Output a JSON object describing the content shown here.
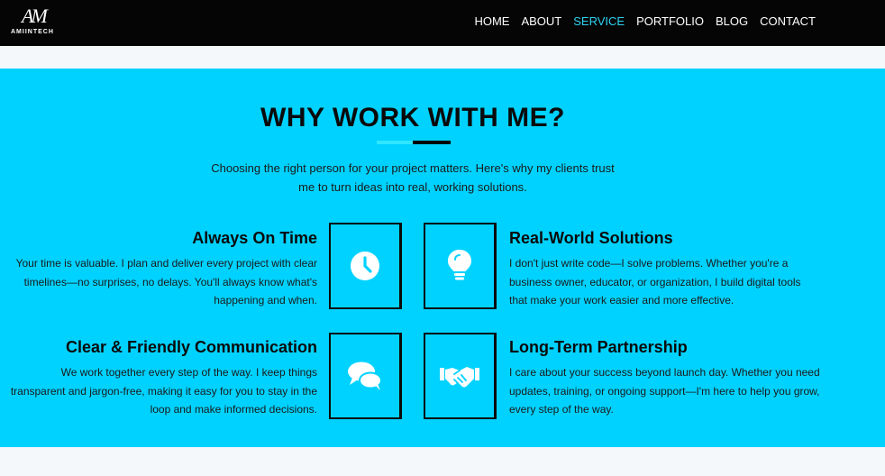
{
  "brand": {
    "logo_mark": "AM",
    "logo_text": "AMIINTECH"
  },
  "nav": [
    {
      "label": "HOME",
      "active": false
    },
    {
      "label": "ABOUT",
      "active": false
    },
    {
      "label": "SERVICE",
      "active": true
    },
    {
      "label": "PORTFOLIO",
      "active": false
    },
    {
      "label": "BLOG",
      "active": false
    },
    {
      "label": "CONTACT",
      "active": false
    }
  ],
  "section": {
    "title": "WHY WORK WITH ME?",
    "intro": "Choosing the right person for your project matters. Here's why my clients trust me to turn ideas into real, working solutions."
  },
  "features": {
    "on_time": {
      "title": "Always On Time",
      "text": "Your time is valuable. I plan and deliver every project with clear timelines—no surprises, no delays. You'll always know what's happening and when.",
      "icon": "clock-icon"
    },
    "real_world": {
      "title": "Real-World Solutions",
      "text": "I don't just write code—I solve problems. Whether you're a business owner, educator, or organization, I build digital tools that make your work easier and more effective.",
      "icon": "lightbulb-icon"
    },
    "communication": {
      "title": "Clear & Friendly Communication",
      "text": "We work together every step of the way. I keep things transparent and jargon-free, making it easy for you to stay in the loop and make informed decisions.",
      "icon": "chat-bubbles-icon"
    },
    "partnership": {
      "title": "Long-Term Partnership",
      "text": "I care about your success beyond launch day. Whether you need updates, training, or ongoing support—I'm here to help you grow, every step of the way.",
      "icon": "handshake-icon"
    }
  },
  "colors": {
    "band": "#00d2ff",
    "navbar": "#050505",
    "active_nav": "#2fd3f1",
    "accent_line": "#2fe6ff"
  }
}
